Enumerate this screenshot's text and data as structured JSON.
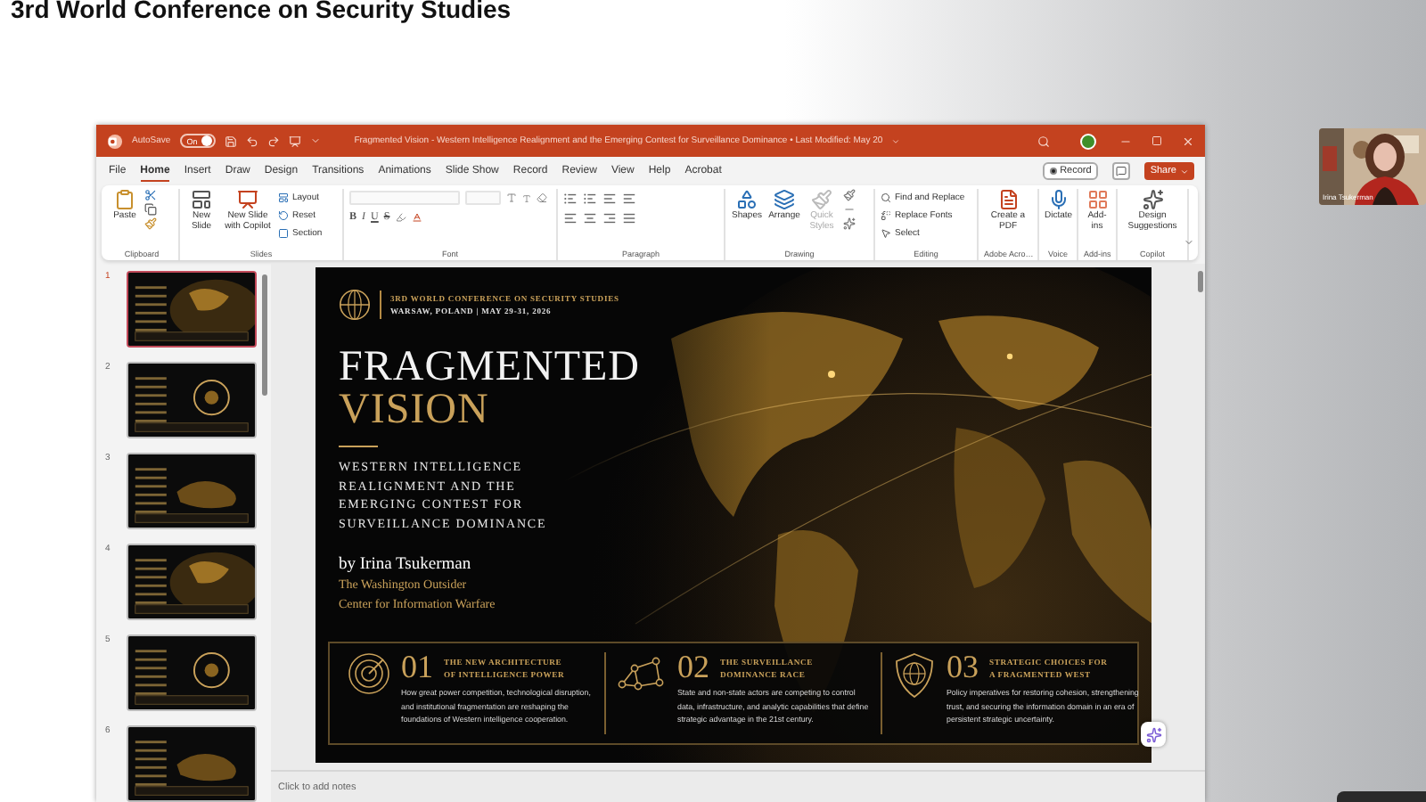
{
  "page_heading": "3rd World Conference on Security Studies",
  "window": {
    "autosave": {
      "label": "AutoSave",
      "state_label": "On",
      "on": true
    },
    "title": "Fragmented Vision - Western Intelligence Realignment and the Emerging Contest for Surveillance Dominance • Last Modified: May 20"
  },
  "menu_tabs": [
    {
      "label": "File",
      "selected": false
    },
    {
      "label": "Home",
      "selected": true
    },
    {
      "label": "Insert",
      "selected": false
    },
    {
      "label": "Draw",
      "selected": false
    },
    {
      "label": "Design",
      "selected": false
    },
    {
      "label": "Transitions",
      "selected": false
    },
    {
      "label": "Animations",
      "selected": false
    },
    {
      "label": "Slide Show",
      "selected": false
    },
    {
      "label": "Record",
      "selected": false
    },
    {
      "label": "Review",
      "selected": false
    },
    {
      "label": "View",
      "selected": false
    },
    {
      "label": "Help",
      "selected": false
    },
    {
      "label": "Acrobat",
      "selected": false
    }
  ],
  "record_button": "Record",
  "share_button": "Share",
  "ribbon_groups": [
    {
      "kind": "clipboard",
      "name": "Clipboard",
      "items": [
        "Paste"
      ]
    },
    {
      "kind": "slides",
      "name": "Slides",
      "items": [
        "New Slide",
        "New Slide with Copilot",
        "Layout",
        "Reset",
        "Section"
      ]
    },
    {
      "kind": "font",
      "name": "Font",
      "items": [
        "B",
        "I",
        "U",
        "S"
      ]
    },
    {
      "kind": "paragraph",
      "name": "Paragraph"
    },
    {
      "kind": "drawing",
      "name": "Drawing",
      "items": [
        {
          "label": "Shapes",
          "disabled": false
        },
        {
          "label": "Arrange",
          "disabled": false
        },
        {
          "label": "Quick Styles",
          "disabled": true
        }
      ]
    },
    {
      "kind": "editing",
      "name": "Editing",
      "items": [
        "Find and Replace",
        "Replace Fonts",
        "Select"
      ]
    },
    {
      "kind": "large",
      "name": "Adobe Acro…",
      "items": [
        "Create a PDF"
      ]
    },
    {
      "kind": "large",
      "name": "Voice",
      "items": [
        "Dictate"
      ]
    },
    {
      "kind": "large",
      "name": "Add-ins",
      "items": [
        "Add-ins"
      ]
    },
    {
      "kind": "large",
      "name": "Copilot",
      "items": [
        "Design Suggestions"
      ]
    }
  ],
  "slides_pane": {
    "thumbnails": [
      {
        "number": "1",
        "selected": true
      },
      {
        "number": "2",
        "selected": false
      },
      {
        "number": "3",
        "selected": false
      },
      {
        "number": "4",
        "selected": false
      },
      {
        "number": "5",
        "selected": false
      },
      {
        "number": "6",
        "selected": false
      }
    ]
  },
  "slide": {
    "conference": "3RD WORLD CONFERENCE ON SECURITY STUDIES",
    "location": "WARSAW, POLAND | MAY 29-31, 2026",
    "title_line_1": "FRAGMENTED",
    "title_line_2": "VISION",
    "subtitle": [
      "WESTERN INTELLIGENCE",
      "REALIGNMENT AND THE",
      "EMERGING CONTEST FOR",
      "SURVEILLANCE DOMINANCE"
    ],
    "author": "by Irina Tsukerman",
    "affiliation": [
      "The Washington Outsider",
      "Center for Information Warfare"
    ],
    "pillars": [
      {
        "number": "01",
        "title": [
          "THE NEW ARCHITECTURE",
          "OF INTELLIGENCE POWER"
        ],
        "text": "How great power competition, technological disruption, and institutional fragmentation are reshaping the foundations of Western intelligence cooperation."
      },
      {
        "number": "02",
        "title": [
          "THE SURVEILLANCE",
          "DOMINANCE RACE"
        ],
        "text": "State and non-state actors are competing to control data, infrastructure, and analytic capabilities that define strategic advantage in the 21st century."
      },
      {
        "number": "03",
        "title": [
          "STRATEGIC CHOICES FOR",
          "A FRAGMENTED WEST"
        ],
        "text": "Policy imperatives for restoring cohesion, strengthening trust, and securing the information domain in an era of persistent strategic uncertainty."
      }
    ]
  },
  "notes_placeholder": "Click to add notes",
  "video_tile": {
    "name_label": "Irina Tsukerman"
  }
}
